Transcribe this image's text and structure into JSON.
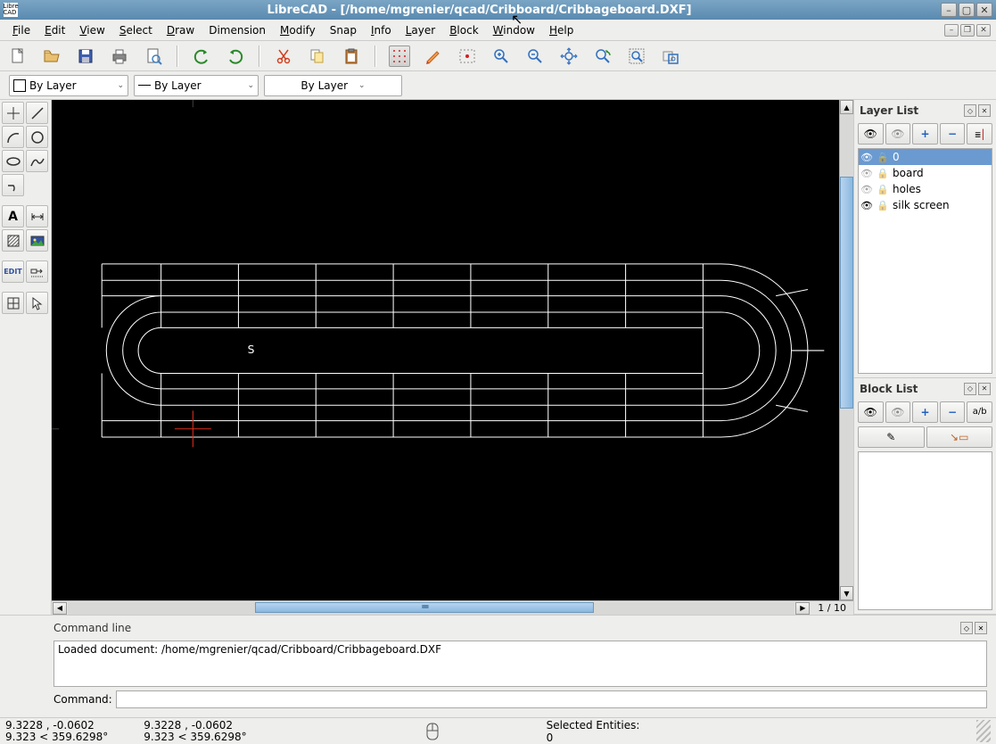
{
  "window": {
    "app_icon_text": "Libre\nCAD",
    "title": "LibreCAD - [/home/mgrenier/qcad/Cribboard/Cribbageboard.DXF]"
  },
  "menu": {
    "items": [
      {
        "u": "F",
        "rest": "ile"
      },
      {
        "u": "E",
        "rest": "dit"
      },
      {
        "u": "V",
        "rest": "iew"
      },
      {
        "u": "S",
        "rest": "elect"
      },
      {
        "u": "D",
        "rest": "raw"
      },
      {
        "u": "",
        "rest": "Dimension"
      },
      {
        "u": "M",
        "rest": "odify"
      },
      {
        "u": "",
        "rest": "Snap"
      },
      {
        "u": "I",
        "rest": "nfo"
      },
      {
        "u": "L",
        "rest": "ayer"
      },
      {
        "u": "B",
        "rest": "lock"
      },
      {
        "u": "W",
        "rest": "indow"
      },
      {
        "u": "H",
        "rest": "elp"
      }
    ]
  },
  "props": {
    "color": "By Layer",
    "width": "By Layer",
    "linetype": "By Layer"
  },
  "layers": {
    "title": "Layer List",
    "items": [
      {
        "name": "0",
        "selected": true,
        "visible": true,
        "frozen": false
      },
      {
        "name": "board",
        "selected": false,
        "visible": false,
        "frozen": false
      },
      {
        "name": "holes",
        "selected": false,
        "visible": false,
        "frozen": false
      },
      {
        "name": "silk screen",
        "selected": false,
        "visible": true,
        "frozen": false
      }
    ]
  },
  "blocks": {
    "title": "Block List"
  },
  "scroll": {
    "page_label": "1 / 10"
  },
  "cmd": {
    "title": "Command line",
    "log": "Loaded document: /home/mgrenier/qcad/Cribboard/Cribbageboard.DXF",
    "prompt": "Command:",
    "value": ""
  },
  "status": {
    "abs_xy": "9.3228 , -0.0602",
    "abs_pol": "9.323 < 359.6298°",
    "rel_xy": "9.3228 , -0.0602",
    "rel_pol": "9.323 < 359.6298°",
    "sel_label": "Selected Entities:",
    "sel_count": "0"
  },
  "toolbar_icons": {
    "new": "new",
    "open": "open",
    "save": "save",
    "print": "print",
    "printpreview": "print-preview",
    "undo": "undo",
    "redo": "redo",
    "cut": "cut",
    "copy": "copy",
    "paste": "paste",
    "grid": "grid",
    "draft": "draft",
    "statusbar": "statusbar",
    "zoomin": "zoom-in",
    "zoomout": "zoom-out",
    "zoomauto": "zoom-auto",
    "zoomprev": "zoom-prev",
    "zoomwin": "zoom-window",
    "zoompan": "zoom-pan"
  }
}
